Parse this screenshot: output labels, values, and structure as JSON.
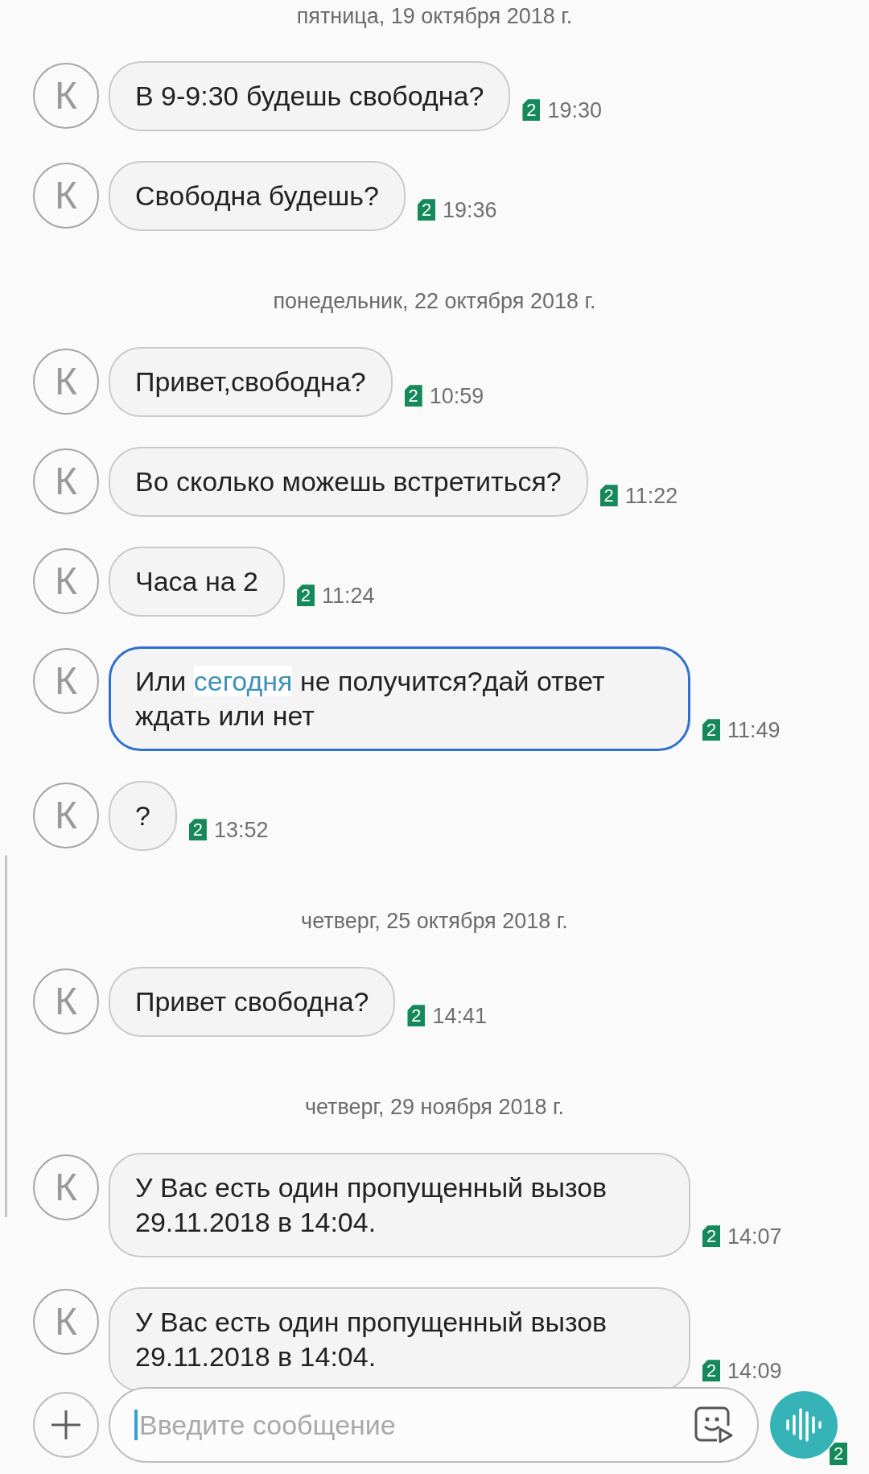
{
  "feed": [
    {
      "kind": "date",
      "text": "пятница, 19 октября 2018 г."
    },
    {
      "kind": "message",
      "avatar": "К",
      "segments": [
        {
          "kind": "plain",
          "text": "В 9-9:30 будешь свободна?"
        }
      ],
      "sim": "2",
      "time": "19:30",
      "selected": false
    },
    {
      "kind": "message",
      "avatar": "К",
      "segments": [
        {
          "kind": "plain",
          "text": "Свободна будешь?"
        }
      ],
      "sim": "2",
      "time": "19:36",
      "selected": false
    },
    {
      "kind": "date",
      "text": "понедельник, 22 октября 2018 г."
    },
    {
      "kind": "message",
      "avatar": "К",
      "segments": [
        {
          "kind": "plain",
          "text": "Привет,свободна?"
        }
      ],
      "sim": "2",
      "time": "10:59",
      "selected": false
    },
    {
      "kind": "message",
      "avatar": "К",
      "segments": [
        {
          "kind": "plain",
          "text": "Во сколько можешь встретиться?"
        }
      ],
      "sim": "2",
      "time": "11:22",
      "selected": false
    },
    {
      "kind": "message",
      "avatar": "К",
      "segments": [
        {
          "kind": "plain",
          "text": "Часа на 2"
        }
      ],
      "sim": "2",
      "time": "11:24",
      "selected": false
    },
    {
      "kind": "message",
      "avatar": "К",
      "segments": [
        {
          "kind": "plain",
          "text": "Или "
        },
        {
          "kind": "link",
          "text": "сегодня"
        },
        {
          "kind": "plain",
          "text": " не получится?дай ответ ждать или нет"
        }
      ],
      "sim": "2",
      "time": "11:49",
      "selected": true
    },
    {
      "kind": "message",
      "avatar": "К",
      "segments": [
        {
          "kind": "plain",
          "text": "?"
        }
      ],
      "sim": "2",
      "time": "13:52",
      "selected": false
    },
    {
      "kind": "date",
      "text": "четверг, 25 октября 2018 г."
    },
    {
      "kind": "message",
      "avatar": "К",
      "segments": [
        {
          "kind": "plain",
          "text": "Привет свободна?"
        }
      ],
      "sim": "2",
      "time": "14:41",
      "selected": false
    },
    {
      "kind": "date",
      "text": "четверг, 29 ноября 2018 г."
    },
    {
      "kind": "message",
      "avatar": "К",
      "segments": [
        {
          "kind": "plain",
          "text": "У Вас есть один пропущенный вызов 29.11.2018 в 14:04."
        }
      ],
      "sim": "2",
      "time": "14:07",
      "selected": false
    },
    {
      "kind": "message",
      "avatar": "К",
      "segments": [
        {
          "kind": "plain",
          "text": "У Вас есть один пропущенный вызов 29.11.2018 в 14:04."
        }
      ],
      "sim": "2",
      "time": "14:09",
      "selected": false
    }
  ],
  "composer": {
    "placeholder": "Введите сообщение",
    "voice_sim": "2"
  }
}
